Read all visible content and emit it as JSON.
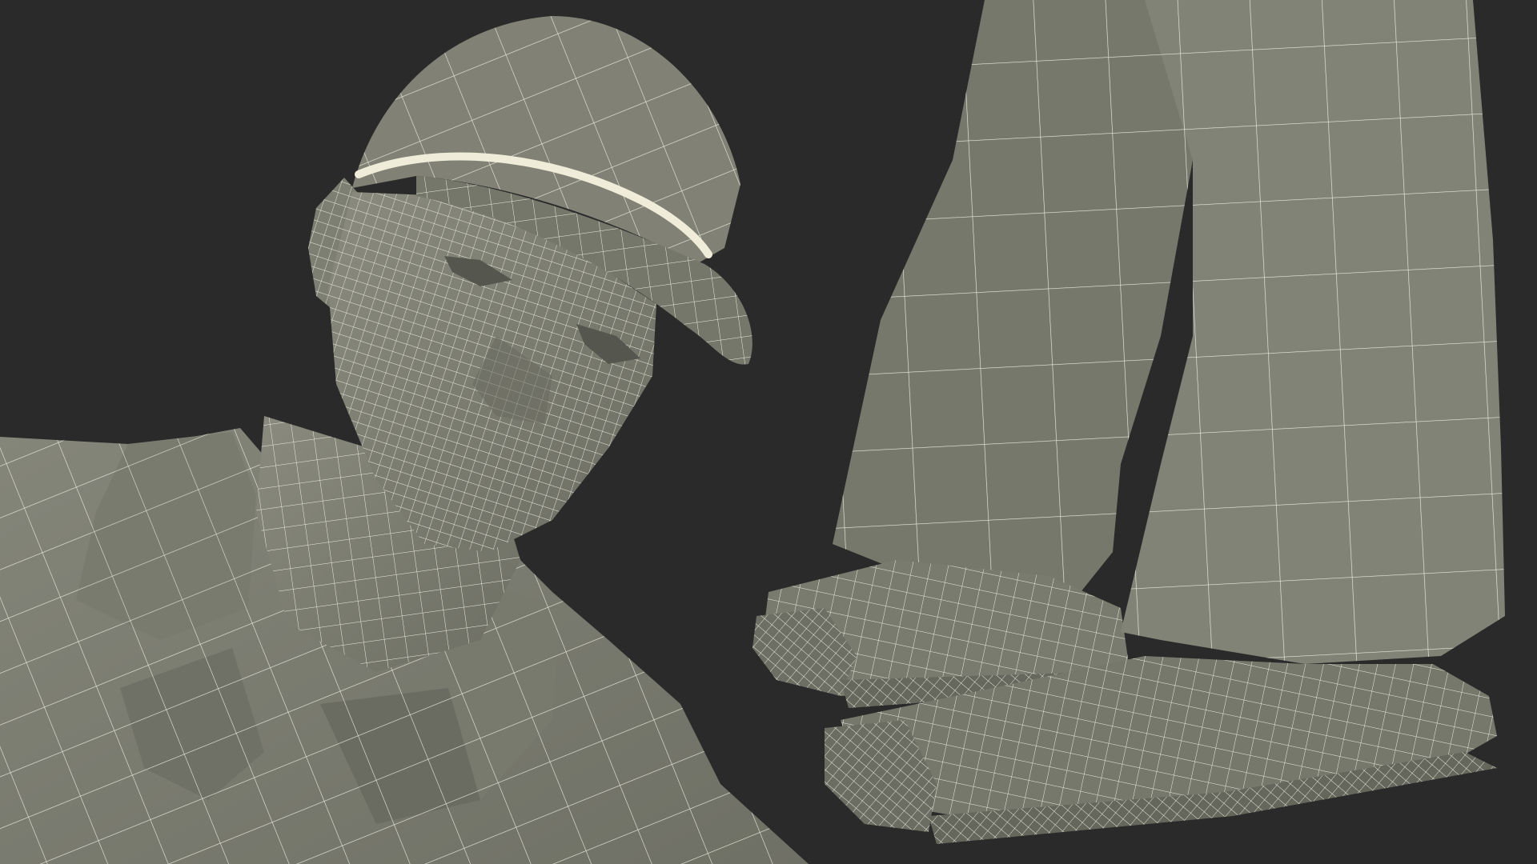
{
  "scene": {
    "background_color": "#2a2a2a",
    "mesh_fill_color": "#7c7d70",
    "mesh_shadow_color": "#5e5f55",
    "mesh_highlight_color": "#8d8e80",
    "wire_color": "#eeeee2",
    "cap_stripe_color": "#efedd9"
  },
  "views": [
    {
      "name": "upper-body-closeup"
    },
    {
      "name": "feet-closeup"
    }
  ]
}
